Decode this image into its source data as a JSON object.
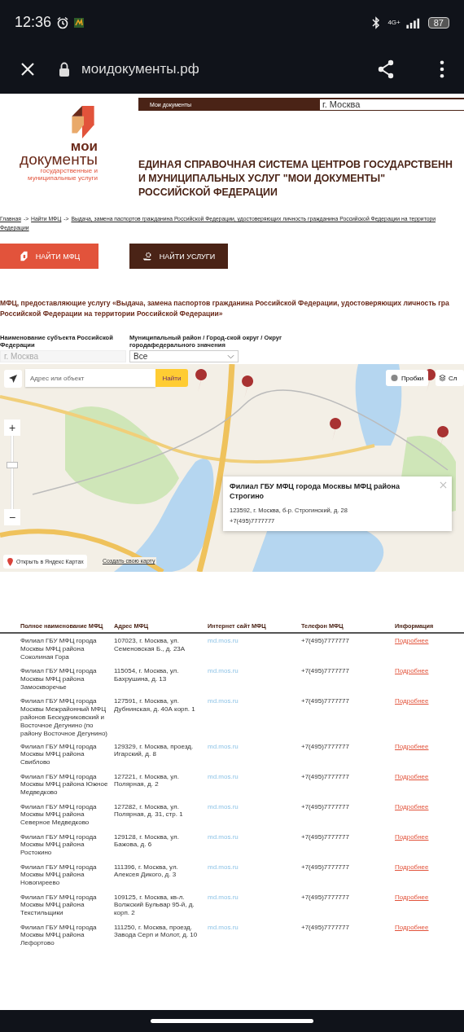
{
  "status_bar": {
    "time": "12:36",
    "network": "4G+",
    "battery": "87"
  },
  "browser": {
    "url": "моидокументы.рф"
  },
  "header": {
    "nav_label": "Мои документы",
    "region_value": "г. Москва",
    "logo": {
      "line_1": "мои",
      "line_2": "документы",
      "tagline": [
        "государственные и",
        "муниципальные услуги"
      ]
    },
    "title_lines": [
      "ЕДИНАЯ СПРАВОЧНАЯ СИСТЕМА ЦЕНТРОВ ГОСУДАРСТВЕНН",
      "И МУНИЦИПАЛЬНЫХ УСЛУГ \"МОИ ДОКУМЕНТЫ\"",
      "РОССИЙСКОЙ ФЕДЕРАЦИИ"
    ]
  },
  "breadcrumbs": {
    "items": [
      "Главная",
      "Найти МФЦ"
    ],
    "separator": "->",
    "current_lines": [
      "Выдача, замена паспортов гражданина Российской Федерации, удостоверяющих личность гражданина Российской Федерации на территори",
      "Федерации"
    ]
  },
  "actions": [
    {
      "label": "НАЙТИ МФЦ",
      "kind": "primary"
    },
    {
      "label": "НАЙТИ УСЛУГИ",
      "kind": "secondary"
    }
  ],
  "heading_lines": [
    "МФЦ, предоставляющие услугу «Выдача, замена паспортов гражданина Российской Федерации, удостоверяющих личность гра",
    "Российской Федерации на территории Российской Федерации»"
  ],
  "filters": [
    {
      "label": "Наименование субъекта Российской Федерации",
      "value": "г. Москва",
      "disabled": true
    },
    {
      "label": "Муниципальный район / Город-ской округ / Округ городафедерального значения",
      "value": "Все",
      "disabled": false
    }
  ],
  "map": {
    "search_placeholder": "Адрес или объект",
    "search_button": "Найти",
    "traffic_button": "Пробки",
    "layers_button": "Сл",
    "zoom_in": "+",
    "zoom_out": "−",
    "zoom": {
      "level": 0.6
    },
    "popup": {
      "title": "Филиал ГБУ МФЦ города Москвы МФЦ района Строгино",
      "address": "123592, г. Москва, б-р. Строгинский, д. 28",
      "phone": "+7(495)7777777"
    },
    "open_link": "Открыть в Яндекс Картах",
    "create_link": "Создать свою карту"
  },
  "table": {
    "columns": [
      "Полное наименование МФЦ",
      "Адрес МФЦ",
      "Интернет сайт МФЦ",
      "Телефон МФЦ",
      "Информация"
    ],
    "rows": [
      {
        "name": "Филиал ГБУ МФЦ города Москвы МФЦ района Соколиная Гора",
        "address": "107023, г. Москва, ул. Семеновская Б., д. 23А",
        "site": "md.mos.ru",
        "phone": "+7(495)7777777",
        "info": "Подробнее"
      },
      {
        "name": "Филиал ГБУ МФЦ города Москвы МФЦ района Замоскворечье",
        "address": "115054, г. Москва, ул. Бахрушина, д. 13",
        "site": "md.mos.ru",
        "phone": "+7(495)7777777",
        "info": "Подробнее"
      },
      {
        "name": "Филиал ГБУ МФЦ города Москвы Межрайонный МФЦ районов Бескудниковский и Восточное Дегунино (по району Восточное Дегунино)",
        "address": "127591, г. Москва, ул. Дубнинская, д. 40А корп. 1",
        "site": "md.mos.ru",
        "phone": "+7(495)7777777",
        "info": "Подробнее"
      },
      {
        "name": "Филиал ГБУ МФЦ города Москвы МФЦ района Свиблово",
        "address": "129329, г. Москва, проезд. Игарский, д. 8",
        "site": "md.mos.ru",
        "phone": "+7(495)7777777",
        "info": "Подробнее"
      },
      {
        "name": "Филиал ГБУ МФЦ города Москвы МФЦ района Южное Медведково",
        "address": "127221, г. Москва, ул. Полярная, д. 2",
        "site": "md.mos.ru",
        "phone": "+7(495)7777777",
        "info": "Подробнее"
      },
      {
        "name": "Филиал ГБУ МФЦ города Москвы МФЦ района Северное Медведково",
        "address": "127282, г. Москва, ул. Полярная, д. 31, стр. 1",
        "site": "md.mos.ru",
        "phone": "+7(495)7777777",
        "info": "Подробнее"
      },
      {
        "name": "Филиал ГБУ МФЦ города Москвы МФЦ района Ростокино",
        "address": "129128, г. Москва, ул. Бажова, д. 6",
        "site": "md.mos.ru",
        "phone": "+7(495)7777777",
        "info": "Подробнее"
      },
      {
        "name": "Филиал ГБУ МФЦ города Москвы МФЦ района Новогиреево",
        "address": "111396, г. Москва, ул. Алексея Дикого, д. 3",
        "site": "md.mos.ru",
        "phone": "+7(495)7777777",
        "info": "Подробнее"
      },
      {
        "name": "Филиал ГБУ МФЦ города Москвы МФЦ района Текстильщики",
        "address": "109125, г. Москва, кв-л. Волжский Бульвар 95-й, д. корп. 2",
        "site": "md.mos.ru",
        "phone": "+7(495)7777777",
        "info": "Подробнее"
      },
      {
        "name": "Филиал ГБУ МФЦ города Москвы МФЦ района Лефортово",
        "address": "111250, г. Москва, проезд. Завода Серп и Молот, д. 10",
        "site": "md.mos.ru",
        "phone": "+7(495)7777777",
        "info": "Подробнее"
      }
    ]
  }
}
